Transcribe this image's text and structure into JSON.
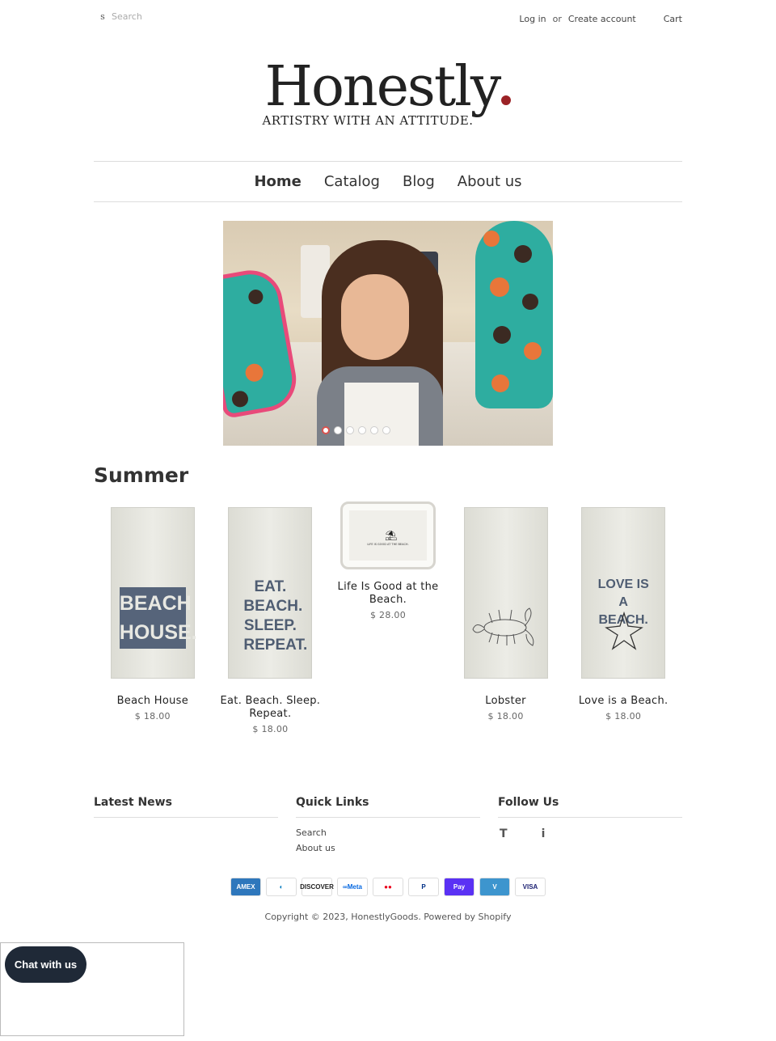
{
  "header": {
    "search_icon": "s",
    "search_placeholder": "Search",
    "login": "Log in",
    "or": "or",
    "create_account": "Create account",
    "cart": "Cart"
  },
  "logo": {
    "name": "Honestly",
    "tagline": "ARTISTRY WITH AN ATTITUDE.",
    "dot_color": "#9b2226"
  },
  "nav": {
    "items": [
      {
        "label": "Home",
        "active": true
      },
      {
        "label": "Catalog",
        "active": false
      },
      {
        "label": "Blog",
        "active": false
      },
      {
        "label": "About us",
        "active": false
      }
    ]
  },
  "slideshow": {
    "slide_count": 6,
    "current_slide": 1
  },
  "collection": {
    "title": "Summer",
    "products": [
      {
        "name": "Beach House",
        "price": "$ 18.00",
        "print": "BEACH HOUSE."
      },
      {
        "name": "Eat. Beach. Sleep. Repeat.",
        "price": "$ 18.00",
        "print": "EAT. BEACH. SLEEP. REPEAT."
      },
      {
        "name": "Life Is Good at the Beach.",
        "price": "$ 28.00",
        "print": "LIFE IS GOOD AT THE BEACH."
      },
      {
        "name": "Lobster",
        "price": "$ 18.00"
      },
      {
        "name": "Love is a Beach.",
        "price": "$ 18.00",
        "print": "LOVE IS A BEACH."
      }
    ]
  },
  "footer": {
    "latest_news": "Latest News",
    "quick_links": "Quick Links",
    "quick_link_items": [
      "Search",
      "About us"
    ],
    "follow_us": "Follow Us",
    "social_icons": [
      "T",
      "i"
    ],
    "payments": [
      {
        "name": "AMEX",
        "bg": "#2e77bc",
        "fg": "#ffffff"
      },
      {
        "name": "◐",
        "bg": "#ffffff",
        "fg": "#0079be"
      },
      {
        "name": "DISCOVER",
        "bg": "#ffffff",
        "fg": "#222222"
      },
      {
        "name": "∞Meta",
        "bg": "#ffffff",
        "fg": "#0668e1"
      },
      {
        "name": "●●",
        "bg": "#ffffff",
        "fg": "#eb001b"
      },
      {
        "name": "P",
        "bg": "#ffffff",
        "fg": "#003087"
      },
      {
        "name": "Pay",
        "bg": "#5a31f4",
        "fg": "#ffffff"
      },
      {
        "name": "V",
        "bg": "#3d95ce",
        "fg": "#ffffff"
      },
      {
        "name": "VISA",
        "bg": "#ffffff",
        "fg": "#1a1f71"
      }
    ],
    "copyright_prefix": "Copyright © 2023,",
    "store_name": "HonestlyGoods",
    "powered": ". Powered by Shopify"
  },
  "chat": {
    "label": "Chat with us"
  }
}
